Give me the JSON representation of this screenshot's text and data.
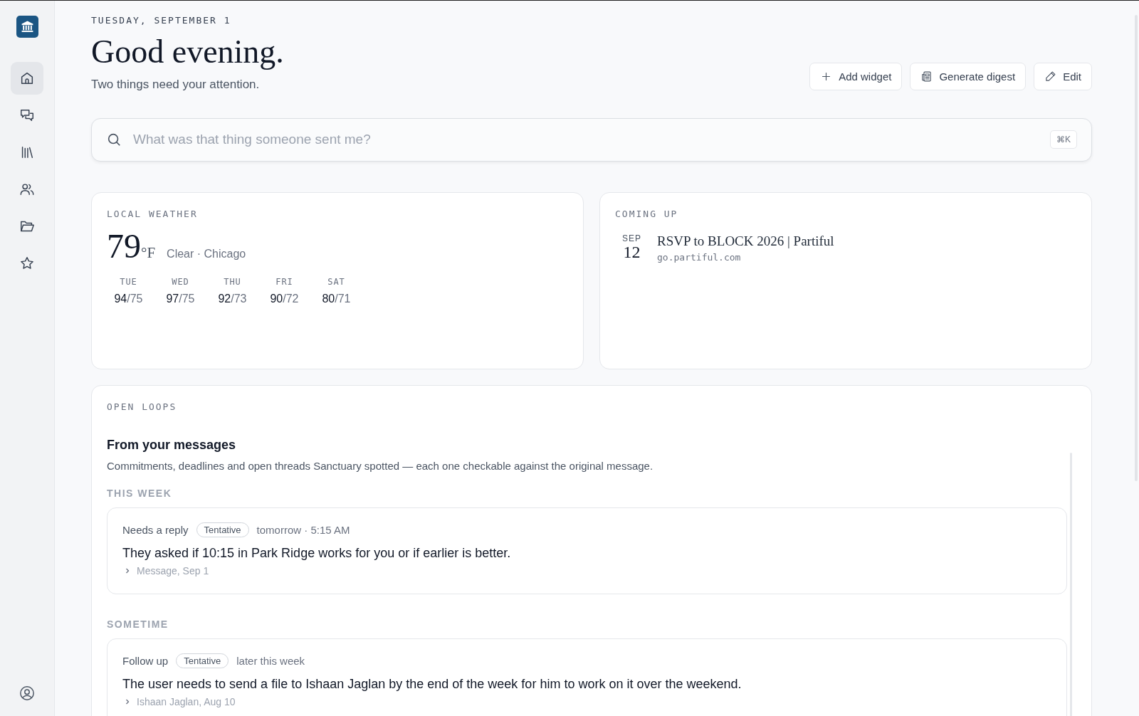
{
  "sidebar": {
    "items": [
      {
        "kind": "home",
        "selected": true
      },
      {
        "kind": "chat",
        "selected": false
      },
      {
        "kind": "library",
        "selected": false
      },
      {
        "kind": "people",
        "selected": false
      },
      {
        "kind": "folder",
        "selected": false
      },
      {
        "kind": "star",
        "selected": false
      }
    ]
  },
  "header": {
    "date": "TUESDAY, SEPTEMBER 1",
    "greeting": "Good evening.",
    "subtitle": "Two things need your attention."
  },
  "actions": [
    {
      "kind": "add",
      "label": "Add widget"
    },
    {
      "kind": "digest",
      "label": "Generate digest"
    },
    {
      "kind": "edit",
      "label": "Edit"
    }
  ],
  "search": {
    "placeholder": "What was that thing someone sent me?",
    "shortcut": "⌘K"
  },
  "weather": {
    "title": "LOCAL WEATHER",
    "temperature": "79",
    "unit": "°F",
    "summary": "Clear · Chicago",
    "forecast": [
      {
        "day": "TUE",
        "high": "94",
        "low": "/75"
      },
      {
        "day": "WED",
        "high": "97",
        "low": "/75"
      },
      {
        "day": "THU",
        "high": "92",
        "low": "/73"
      },
      {
        "day": "FRI",
        "high": "90",
        "low": "/72"
      },
      {
        "day": "SAT",
        "high": "80",
        "low": "/71"
      }
    ]
  },
  "coming_up": {
    "title": "COMING UP",
    "events": [
      {
        "month": "SEP",
        "day": "12",
        "title": "RSVP to BLOCK 2026 | Partiful",
        "source": "go.partiful.com"
      }
    ]
  },
  "open_loops": {
    "title": "OPEN LOOPS",
    "heading": "From your messages",
    "description": "Commitments, deadlines and open threads Sanctuary spotted — each one checkable against the original message.",
    "groups": [
      {
        "label": "THIS WEEK",
        "items": [
          {
            "type": "Needs a reply",
            "tag": "Tentative",
            "when": "tomorrow · 5:15 AM",
            "text": "They asked if 10:15 in Park Ridge works for you or if earlier is better.",
            "source": "Message, Sep 1"
          }
        ]
      },
      {
        "label": "SOMETIME",
        "items": [
          {
            "type": "Follow up",
            "tag": "Tentative",
            "when": "later this week",
            "text": "The user needs to send a file to Ishaan Jaglan by the end of the week for him to work on it over the weekend.",
            "source": "Ishaan Jaglan, Aug 10"
          }
        ]
      }
    ]
  }
}
